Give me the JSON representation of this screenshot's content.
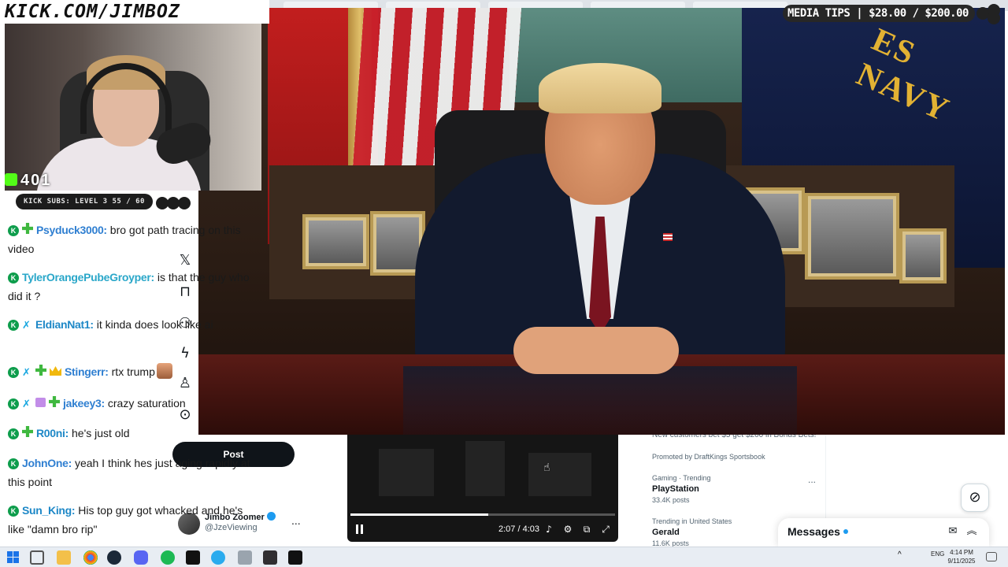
{
  "stream_overlay": {
    "channel_url": "KICK.COM/JIMBOZ",
    "viewer_count": "401",
    "sub_goal": "KICK SUBS: LEVEL 3 55 / 60",
    "media_tips": "MEDIA TIPS | $28.00 / $200.00"
  },
  "chat": {
    "messages": [
      {
        "user": "Psyduck3000:",
        "user_color": "#2f7fd1",
        "text": "bro got path tracing on this video"
      },
      {
        "user": "TylerOrangePubeGroyper:",
        "user_color": "#2aa7c9",
        "text": "is that the guy who did it ?"
      },
      {
        "user": "EldianNat1:",
        "user_color": "#1e88c7",
        "text": "it kinda does look like ai"
      },
      {
        "user": "Stingerr:",
        "user_color": "#2f7fd1",
        "text": "rtx trump"
      },
      {
        "user": "jakeey3:",
        "user_color": "#2f7fd1",
        "text": "crazy saturation"
      },
      {
        "user": "R00ni:",
        "user_color": "#1e88c7",
        "text": "he's just old"
      },
      {
        "user": "JohnOne:",
        "user_color": "#2f7fd1",
        "text": "yeah I think hes just aging rapidly at this point"
      },
      {
        "user": "Sun_King:",
        "user_color": "#1e88c7",
        "text": "His top guy got whacked and he's like \"damn bro rip\""
      }
    ],
    "badge_letter": "K"
  },
  "x_sidebar": {
    "post_label": "Post",
    "icons": [
      "x-logo-icon",
      "bookmark-icon",
      "communities-icon",
      "premium-bolt-icon",
      "profile-icon",
      "more-circle-icon"
    ],
    "profile": {
      "name": "Jimbo Zoomer",
      "handle": "@JzeViewing",
      "more": "..."
    }
  },
  "embedded_video": {
    "time": "2:07 / 4:03",
    "progress": 0.52
  },
  "right_column": {
    "promo_text": "New customers bet $5 get $200 in Bonus Bets!",
    "promoted_by": "Promoted by DraftKings Sportsbook",
    "trends": [
      {
        "meta": "Gaming · Trending",
        "name": "PlayStation",
        "count": "33.4K posts"
      },
      {
        "meta": "Trending in United States",
        "name": "Gerald",
        "count": "11.6K posts"
      }
    ],
    "more": "..."
  },
  "messages_drawer": {
    "title": "Messages"
  },
  "taskbar": {
    "lang": "ENG",
    "time": "4:14 PM",
    "date": "9/11/2025"
  },
  "colors": {
    "kick_green": "#53fc18",
    "x_blue": "#1d9bf0",
    "x_black": "#0f1419"
  }
}
